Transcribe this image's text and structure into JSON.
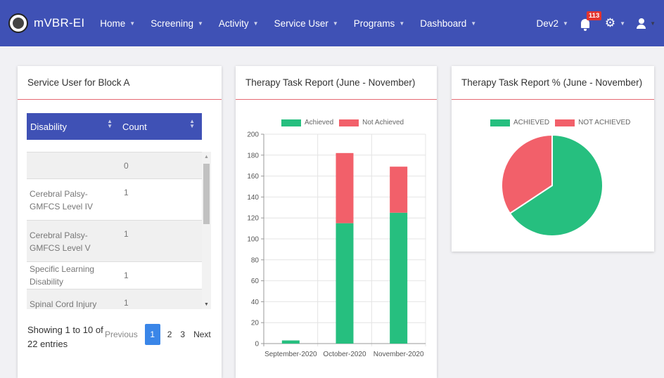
{
  "navbar": {
    "brand": "mVBR-EI",
    "menu": [
      {
        "label": "Home"
      },
      {
        "label": "Screening"
      },
      {
        "label": "Activity"
      },
      {
        "label": "Service User"
      },
      {
        "label": "Programs"
      },
      {
        "label": "Dashboard"
      }
    ],
    "user": "Dev2",
    "notification_count": "113",
    "icons": {
      "bell": "bell-icon",
      "settings": "cogs-icon",
      "user": "user-icon"
    },
    "color": "#3f51b5"
  },
  "table_card": {
    "title": "Service User for Block A",
    "columns": [
      "Disability",
      "Count"
    ],
    "rows": [
      {
        "disability": "",
        "count": "0"
      },
      {
        "disability": "Cerebral Palsy- GMFCS Level IV",
        "count": "1"
      },
      {
        "disability": "Cerebral Palsy- GMFCS Level V",
        "count": "1"
      },
      {
        "disability": "Specific Learning Disability",
        "count": "1"
      },
      {
        "disability": "Spinal Cord Injury",
        "count": "1"
      }
    ],
    "info": "Showing 1 to 10 of 22 entries",
    "pagination": {
      "previous": "Previous",
      "pages": [
        "1",
        "2",
        "3"
      ],
      "active": "1",
      "next": "Next"
    }
  },
  "bar_card": {
    "title": "Therapy Task Report (June - November)"
  },
  "pie_card": {
    "title": "Therapy Task Report % (June - November)"
  },
  "chart_data": [
    {
      "type": "bar",
      "stacked": true,
      "categories": [
        "September-2020",
        "October-2020",
        "November-2020"
      ],
      "series": [
        {
          "name": "Achieved",
          "values": [
            3,
            115,
            125
          ],
          "color": "#26bf7f"
        },
        {
          "name": "Not Achieved",
          "values": [
            0,
            67,
            44
          ],
          "color": "#f2606a"
        }
      ],
      "ylim": [
        0,
        200
      ],
      "yticks": [
        0,
        20,
        40,
        60,
        80,
        100,
        120,
        140,
        160,
        180,
        200
      ],
      "legend": "top",
      "grid": true
    },
    {
      "type": "pie",
      "labels": [
        "ACHIEVED",
        "NOT ACHIEVED"
      ],
      "values": [
        65.7,
        34.3
      ],
      "colors": [
        "#26bf7f",
        "#f2606a"
      ],
      "legend": "top"
    }
  ]
}
